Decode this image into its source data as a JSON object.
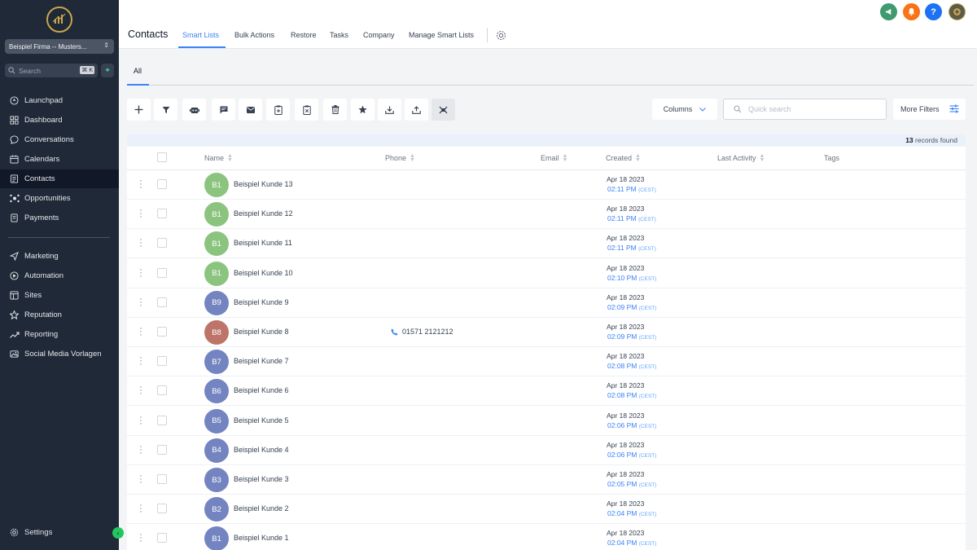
{
  "app": {
    "account_name": "Beispiel Firma -- Musters...",
    "search_placeholder": "Search",
    "search_shortcut": "⌘ K"
  },
  "sidebar": {
    "items": [
      {
        "label": "Launchpad",
        "icon": "rocket-icon"
      },
      {
        "label": "Dashboard",
        "icon": "grid-icon"
      },
      {
        "label": "Conversations",
        "icon": "chat-icon"
      },
      {
        "label": "Calendars",
        "icon": "calendar-icon"
      },
      {
        "label": "Contacts",
        "icon": "contacts-icon",
        "active": true
      },
      {
        "label": "Opportunities",
        "icon": "opportunities-icon"
      },
      {
        "label": "Payments",
        "icon": "payments-icon"
      },
      {
        "label": "Marketing",
        "icon": "send-icon"
      },
      {
        "label": "Automation",
        "icon": "automation-icon"
      },
      {
        "label": "Sites",
        "icon": "sites-icon"
      },
      {
        "label": "Reputation",
        "icon": "star-icon"
      },
      {
        "label": "Reporting",
        "icon": "trend-icon"
      },
      {
        "label": "Social Media Vorlagen",
        "icon": "media-icon"
      }
    ],
    "settings_label": "Settings"
  },
  "header": {
    "title": "Contacts",
    "tabs": [
      "Smart Lists",
      "Bulk Actions",
      "Restore",
      "Tasks",
      "Company",
      "Manage Smart Lists"
    ],
    "active_tab": "Smart Lists"
  },
  "subtabs": {
    "all": "All"
  },
  "toolbar": {
    "columns_label": "Columns",
    "quick_search_placeholder": "Quick search",
    "more_filters_label": "More Filters"
  },
  "records": {
    "count": "13",
    "suffix": " records found"
  },
  "table": {
    "columns": [
      "Name",
      "Phone",
      "Email",
      "Created",
      "Last Activity",
      "Tags"
    ],
    "rows": [
      {
        "initials": "B1",
        "name": "Beispiel Kunde 13",
        "phone": "",
        "date": "Apr 18 2023",
        "time": "02:11 PM",
        "tz": "(CEST)",
        "color": "#8bc47f"
      },
      {
        "initials": "B1",
        "name": "Beispiel Kunde 12",
        "phone": "",
        "date": "Apr 18 2023",
        "time": "02:11 PM",
        "tz": "(CEST)",
        "color": "#8bc47f"
      },
      {
        "initials": "B1",
        "name": "Beispiel Kunde 11",
        "phone": "",
        "date": "Apr 18 2023",
        "time": "02:11 PM",
        "tz": "(CEST)",
        "color": "#8bc47f"
      },
      {
        "initials": "B1",
        "name": "Beispiel Kunde 10",
        "phone": "",
        "date": "Apr 18 2023",
        "time": "02:10 PM",
        "tz": "(CEST)",
        "color": "#8bc47f"
      },
      {
        "initials": "B9",
        "name": "Beispiel Kunde 9",
        "phone": "",
        "date": "Apr 18 2023",
        "time": "02:09 PM",
        "tz": "(CEST)",
        "color": "#7484c1"
      },
      {
        "initials": "B8",
        "name": "Beispiel Kunde 8",
        "phone": "01571 2121212",
        "date": "Apr 18 2023",
        "time": "02:09 PM",
        "tz": "(CEST)",
        "color": "#bd7569"
      },
      {
        "initials": "B7",
        "name": "Beispiel Kunde 7",
        "phone": "",
        "date": "Apr 18 2023",
        "time": "02:08 PM",
        "tz": "(CEST)",
        "color": "#7484c1"
      },
      {
        "initials": "B6",
        "name": "Beispiel Kunde 6",
        "phone": "",
        "date": "Apr 18 2023",
        "time": "02:08 PM",
        "tz": "(CEST)",
        "color": "#7484c1"
      },
      {
        "initials": "B5",
        "name": "Beispiel Kunde 5",
        "phone": "",
        "date": "Apr 18 2023",
        "time": "02:06 PM",
        "tz": "(CEST)",
        "color": "#7484c1"
      },
      {
        "initials": "B4",
        "name": "Beispiel Kunde 4",
        "phone": "",
        "date": "Apr 18 2023",
        "time": "02:06 PM",
        "tz": "(CEST)",
        "color": "#7484c1"
      },
      {
        "initials": "B3",
        "name": "Beispiel Kunde 3",
        "phone": "",
        "date": "Apr 18 2023",
        "time": "02:05 PM",
        "tz": "(CEST)",
        "color": "#7484c1"
      },
      {
        "initials": "B2",
        "name": "Beispiel Kunde 2",
        "phone": "",
        "date": "Apr 18 2023",
        "time": "02:04 PM",
        "tz": "(CEST)",
        "color": "#7484c1"
      },
      {
        "initials": "B1",
        "name": "Beispiel Kunde 1",
        "phone": "",
        "date": "Apr 18 2023",
        "time": "02:04 PM",
        "tz": "(CEST)",
        "color": "#7484c1"
      }
    ]
  },
  "colors": {
    "accent": "#3b82f6",
    "sidebar_bg": "#1f2937",
    "megaphone_btn": "#3f9b6f",
    "bell_btn": "#f97316",
    "help_btn": "#1d72f3"
  },
  "top_icons": {
    "help_glyph": "?"
  }
}
